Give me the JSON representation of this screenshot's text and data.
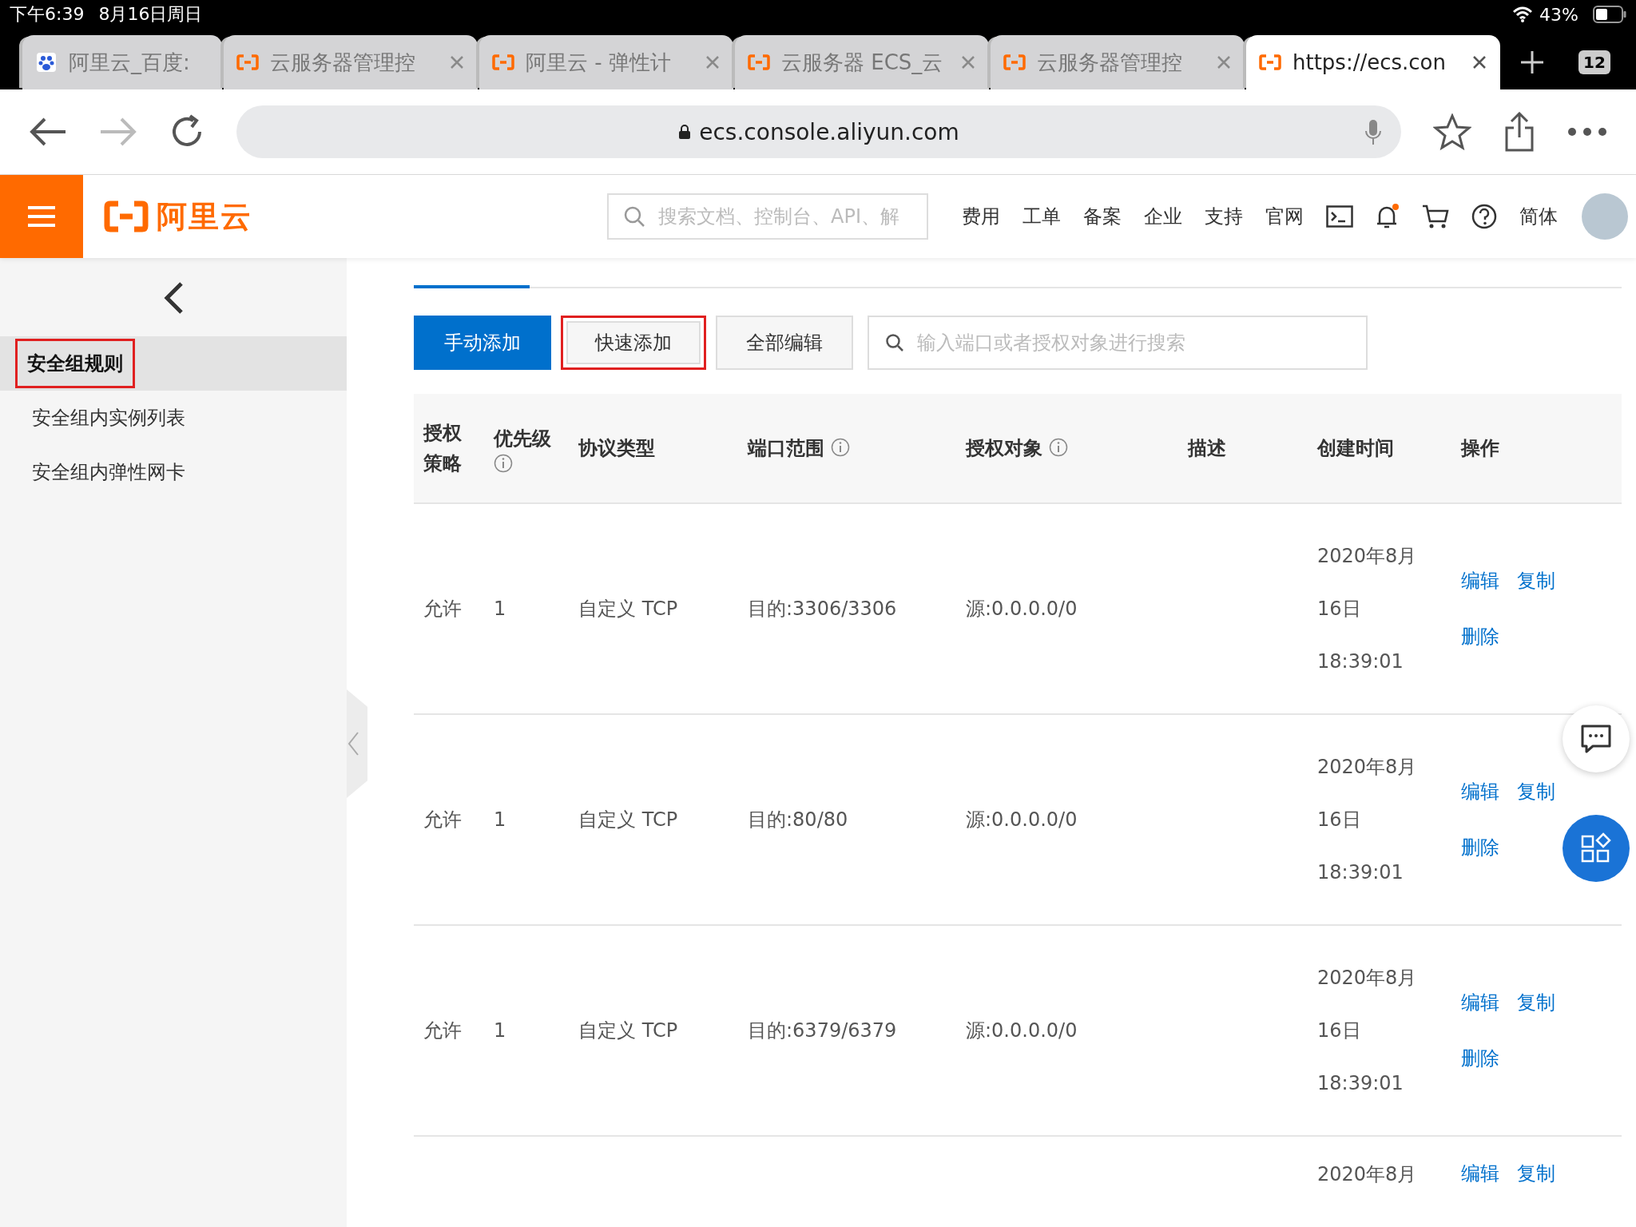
{
  "status_bar": {
    "time": "下午6:39",
    "date": "8月16日周日",
    "battery": "43%"
  },
  "browser_tabs": [
    {
      "title": "阿里云_百度:",
      "kind": "baidu",
      "selected": false,
      "closable": false
    },
    {
      "title": "云服务器管理控",
      "kind": "aliyun",
      "selected": false,
      "closable": true
    },
    {
      "title": "阿里云 - 弹性计",
      "kind": "aliyun",
      "selected": false,
      "closable": true
    },
    {
      "title": "云服务器 ECS_云",
      "kind": "aliyun",
      "selected": false,
      "closable": true
    },
    {
      "title": "云服务器管理控",
      "kind": "aliyun",
      "selected": false,
      "closable": true
    },
    {
      "title": "https://ecs.con",
      "kind": "aliyun",
      "selected": true,
      "closable": true
    }
  ],
  "tab_count": "12",
  "address_bar": {
    "url": "ecs.console.aliyun.com"
  },
  "header": {
    "logo": "阿里云",
    "search_placeholder": "搜索文档、控制台、API、解",
    "nav": [
      "费用",
      "工单",
      "备案",
      "企业",
      "支持",
      "官网"
    ],
    "language": "简体"
  },
  "sidebar": {
    "items": [
      {
        "label": "安全组规则",
        "selected": true,
        "highlighted": true
      },
      {
        "label": "安全组内实例列表",
        "selected": false,
        "highlighted": false
      },
      {
        "label": "安全组内弹性网卡",
        "selected": false,
        "highlighted": false
      }
    ]
  },
  "toolbar": {
    "buttons": [
      {
        "label": "手动添加",
        "kind": "primary",
        "highlighted": false
      },
      {
        "label": "快速添加",
        "kind": "default",
        "highlighted": true
      },
      {
        "label": "全部编辑",
        "kind": "default",
        "highlighted": false
      }
    ],
    "search_placeholder": "输入端口或者授权对象进行搜索"
  },
  "table": {
    "columns": [
      {
        "label": "授权策略",
        "info": false
      },
      {
        "label": "优先级",
        "info": true
      },
      {
        "label": "协议类型",
        "info": false
      },
      {
        "label": "端口范围",
        "info": true
      },
      {
        "label": "授权对象",
        "info": true
      },
      {
        "label": "描述",
        "info": false
      },
      {
        "label": "创建时间",
        "info": false
      },
      {
        "label": "操作",
        "info": false
      }
    ],
    "rows": [
      {
        "policy": "允许",
        "priority": "1",
        "protocol": "自定义 TCP",
        "port_range": "目的:3306/3306",
        "source": "源:0.0.0.0/0",
        "created": [
          "2020年8月",
          "16日",
          "18:39:01"
        ],
        "actions": [
          "编辑",
          "复制",
          "删除"
        ]
      },
      {
        "policy": "允许",
        "priority": "1",
        "protocol": "自定义 TCP",
        "port_range": "目的:80/80",
        "source": "源:0.0.0.0/0",
        "created": [
          "2020年8月",
          "16日",
          "18:39:01"
        ],
        "actions": [
          "编辑",
          "复制",
          "删除"
        ]
      },
      {
        "policy": "允许",
        "priority": "1",
        "protocol": "自定义 TCP",
        "port_range": "目的:6379/6379",
        "source": "源:0.0.0.0/0",
        "created": [
          "2020年8月",
          "16日",
          "18:39:01"
        ],
        "actions": [
          "编辑",
          "复制",
          "删除"
        ]
      },
      {
        "created": [
          "2020年8月"
        ],
        "actions": [
          "编辑",
          "复制"
        ]
      }
    ]
  }
}
